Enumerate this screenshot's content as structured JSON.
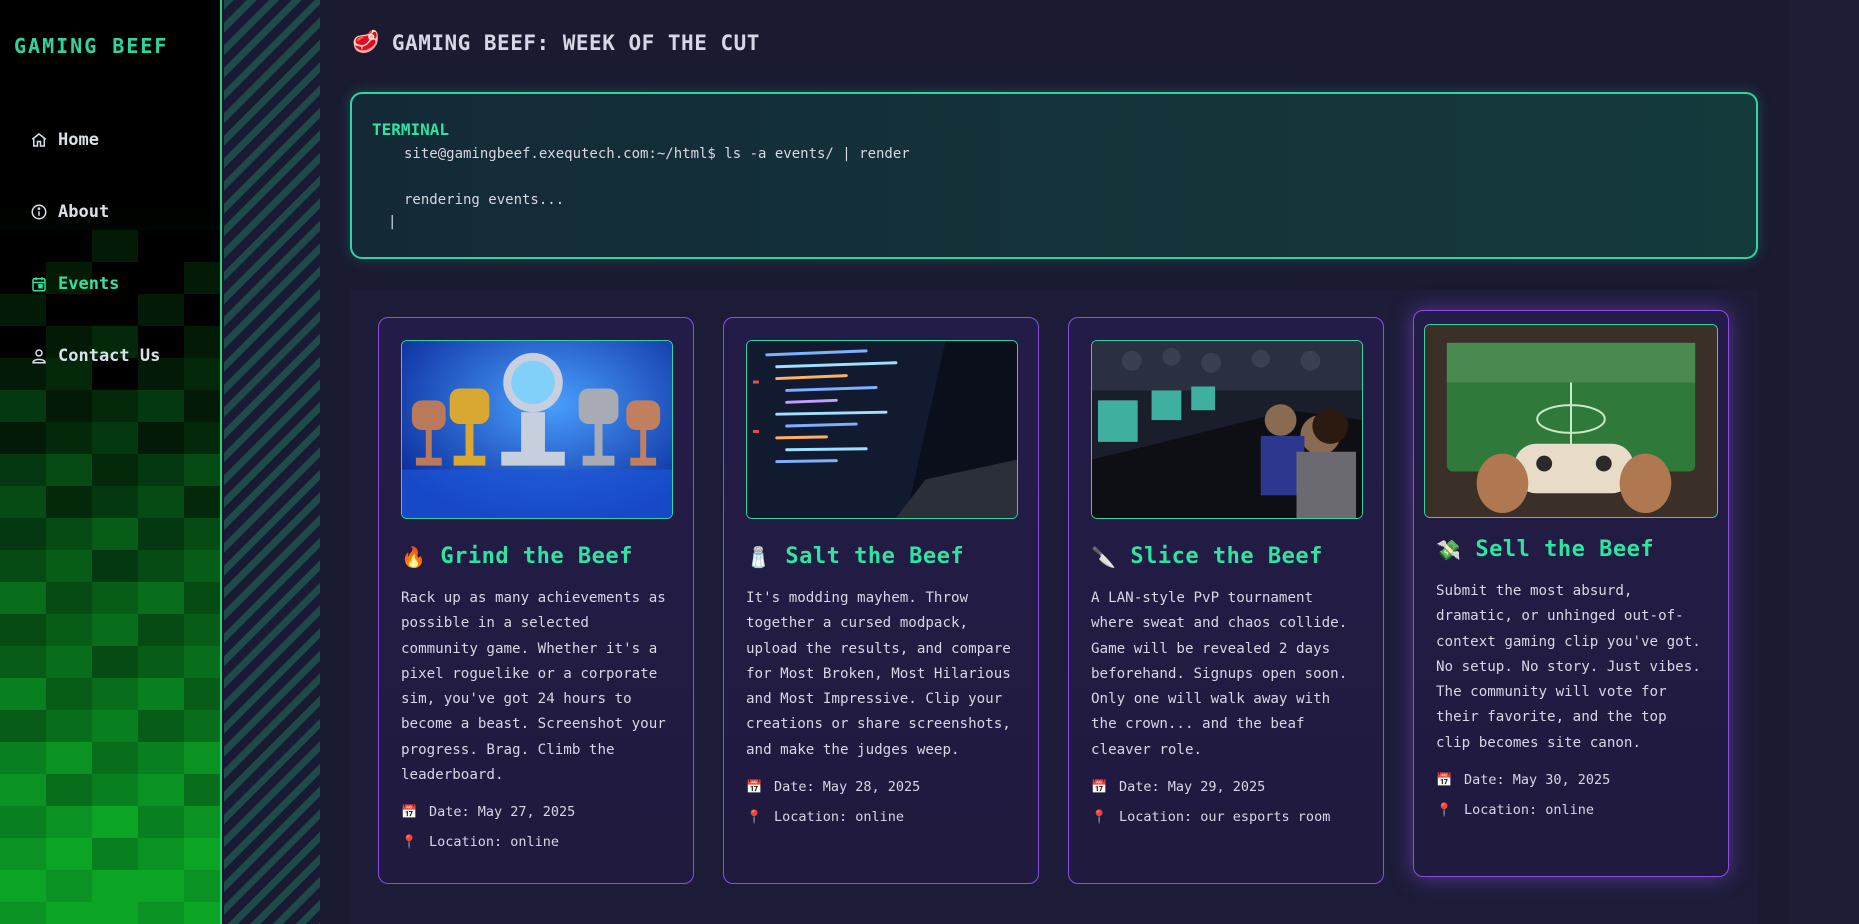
{
  "brand": "GAMING BEEF",
  "nav": [
    {
      "label": "Home",
      "icon": "home-icon"
    },
    {
      "label": "About",
      "icon": "info-icon"
    },
    {
      "label": "Events",
      "icon": "calendar-icon",
      "active": true
    },
    {
      "label": "Contact Us",
      "icon": "user-icon"
    }
  ],
  "page_title": "GAMING BEEF: WEEK OF THE CUT",
  "terminal": {
    "heading": "TERMINAL",
    "command": "site@gamingbeef.exequtech.com:~/html$ ls -a events/ | render",
    "output": "rendering events...",
    "cursor": "|"
  },
  "events": [
    {
      "emoji": "🔥",
      "title": "Grind the Beef",
      "lines": [
        "Rack up as many achievements as",
        "possible in a selected",
        "community game. Whether it's a",
        "pixel roguelike or a corporate",
        "sim, you've got 24 hours to",
        "become a beast. Screenshot your",
        "progress. Brag. Climb the",
        "leaderboard."
      ],
      "date_label": "Date: May 27, 2025",
      "location_label": "Location: online"
    },
    {
      "emoji": "🧂",
      "title": "Salt the Beef",
      "lines": [
        "It's modding mayhem. Throw",
        "together a cursed modpack,",
        "upload the results, and compare",
        "for Most Broken, Most Hilarious",
        "and Most Impressive. Clip your",
        "creations or share screenshots,",
        "and make the judges weep."
      ],
      "date_label": "Date: May 28, 2025",
      "location_label": "Location: online"
    },
    {
      "emoji": "🔪",
      "title": "Slice the Beef",
      "lines": [
        "A LAN-style PvP tournament",
        "where sweat and chaos collide.",
        "Game will be revealed 2 days",
        "beforehand. Signups open soon.",
        "Only one will walk away with",
        "the crown... and the beaf",
        "cleaver role."
      ],
      "date_label": "Date: May 29, 2025",
      "location_label": "Location: our esports room"
    },
    {
      "emoji": "💸",
      "title": "Sell the Beef",
      "lines": [
        "Submit the most absurd,",
        "dramatic, or unhinged out-of-",
        "context gaming clip you've got.",
        "No setup. No story. Just vibes.",
        "The community will vote for",
        "their favorite, and the top",
        "clip becomes site canon."
      ],
      "date_label": "Date: May 30, 2025",
      "location_label": "Location: online"
    }
  ],
  "icons": {
    "date": "calendar-emoji-icon",
    "location": "pin-emoji-icon"
  },
  "colors": {
    "accent": "#2fe3a0",
    "card_border": "#8a4fe0",
    "sidebar_border": "#22d17a"
  }
}
